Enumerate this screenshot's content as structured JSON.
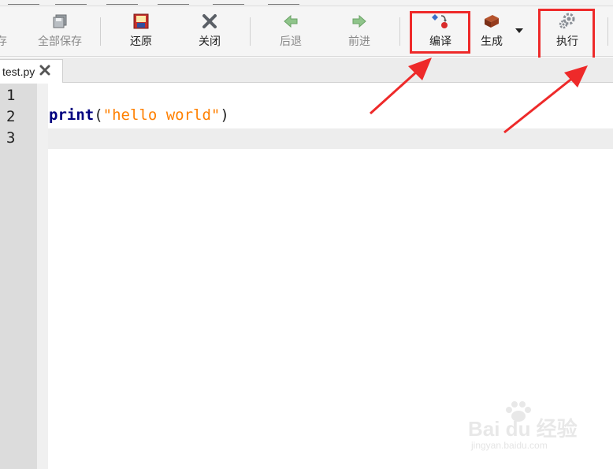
{
  "toolbar": {
    "partial_label": "存",
    "save_all_label": "全部保存",
    "restore_label": "还原",
    "close_label": "关闭",
    "back_label": "后退",
    "forward_label": "前进",
    "compile_label": "编译",
    "build_label": "生成",
    "run_label": "执行"
  },
  "tabs": [
    {
      "title": "test.py"
    }
  ],
  "editor": {
    "line_numbers": [
      "1",
      "2",
      "3"
    ],
    "code_keyword": "print",
    "code_open": "(",
    "code_string": "\"hello world\"",
    "code_close": ")"
  },
  "watermark": {
    "brand": "Bai du 经验",
    "url": "jingyan.baidu.com"
  },
  "colors": {
    "highlight": "#ee2a2a",
    "keyword": "#000080",
    "string": "#ff8000"
  }
}
